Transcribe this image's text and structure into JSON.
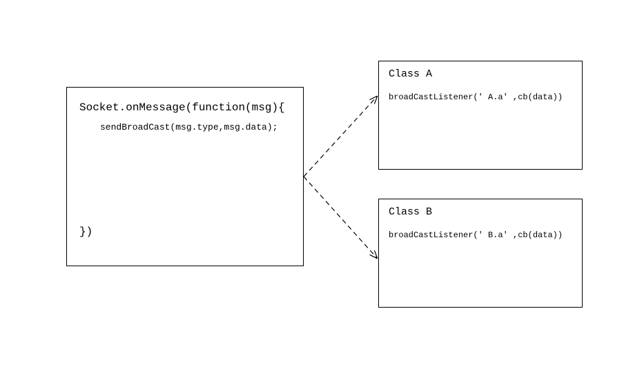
{
  "leftBox": {
    "title": "Socket.onMessage(function(msg){",
    "body": "sendBroadCast(msg.type,msg.data);",
    "close": "})"
  },
  "classA": {
    "title": "Class A",
    "body": "broadCastListener(' A.a' ,cb(data))"
  },
  "classB": {
    "title": "Class B",
    "body": "broadCastListener(' B.a' ,cb(data))"
  }
}
